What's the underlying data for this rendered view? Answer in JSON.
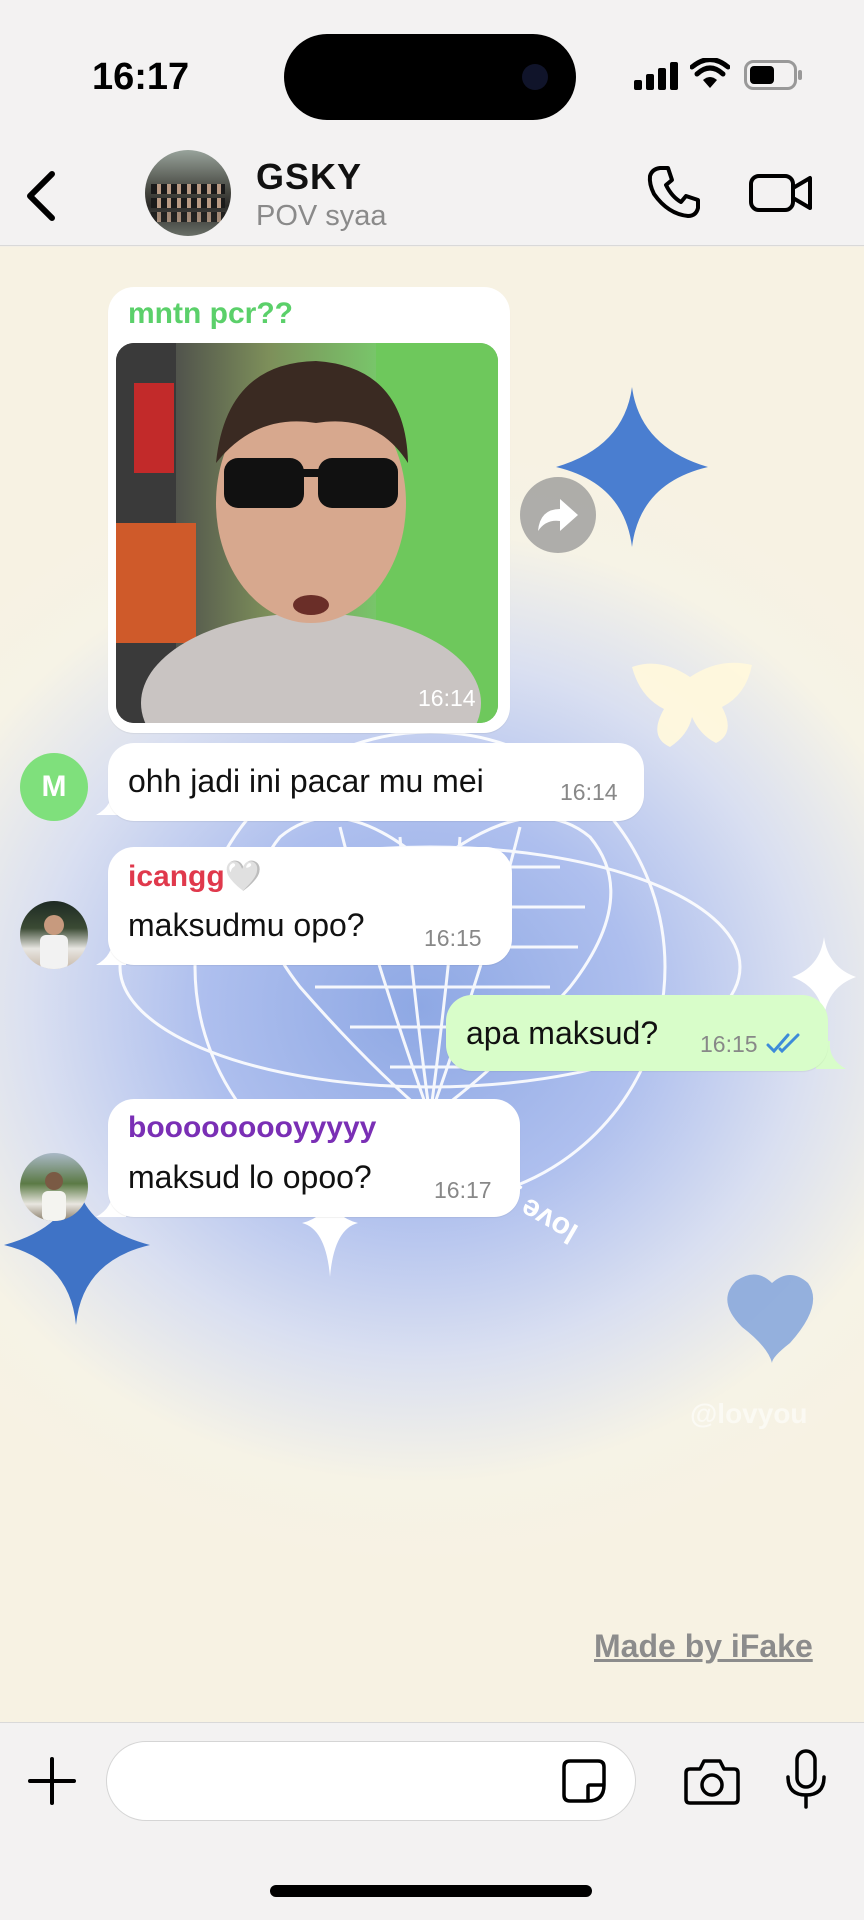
{
  "status_bar": {
    "time": "16:17"
  },
  "header": {
    "title": "GSKY",
    "subtitle": "POV syaa"
  },
  "messages": [
    {
      "sender": "mntn pcr??",
      "sender_color": "#5bd06a",
      "type": "video",
      "time": "16:14"
    },
    {
      "avatar_letter": "M",
      "text": "ohh jadi ini pacar mu mei",
      "time": "16:14"
    },
    {
      "sender": "icangg🤍",
      "sender_color": "#e0394c",
      "text": "maksudmu opo?",
      "time": "16:15"
    },
    {
      "direction": "outgoing",
      "text": "apa maksud?",
      "time": "16:15",
      "status": "read"
    },
    {
      "sender": "booooooooyyyyy",
      "sender_color": "#7a2fb5",
      "text": "maksud lo opoo?",
      "time": "16:17"
    }
  ],
  "wallpaper": {
    "text": "love yourself",
    "watermark": "@lovyou"
  },
  "watermark": "Made by iFake",
  "input": {
    "placeholder": ""
  },
  "colors": {
    "incoming": "#ffffff",
    "outgoing": "#d8fdc9",
    "read_ticks": "#3d8bd9"
  }
}
